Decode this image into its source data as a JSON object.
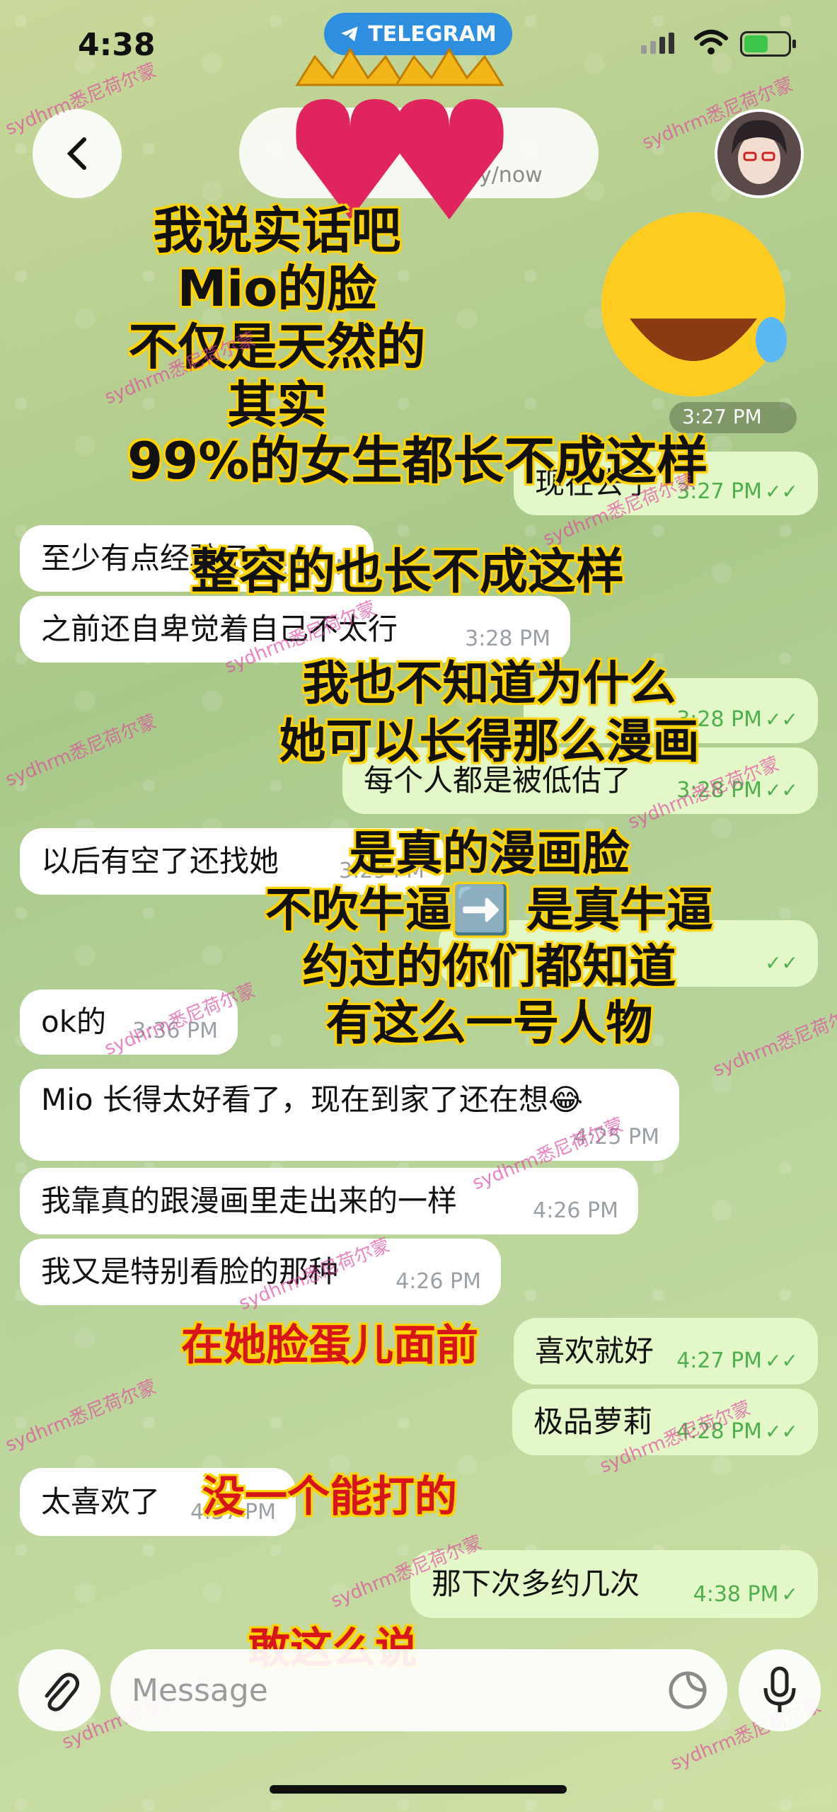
{
  "status_bar": {
    "time": "4:38",
    "app_badge": "TELEGRAM",
    "battery_level": 0.55
  },
  "header": {
    "status": "...ly/now"
  },
  "messages": [
    {
      "dir": "out",
      "text": "现在去了",
      "time": "3:27 PM",
      "check": "✓✓"
    },
    {
      "dir": "in",
      "text": "至少有点经验了",
      "time": "3:28 PM"
    },
    {
      "dir": "in",
      "text": "之前还自卑觉着自己不太行",
      "time": "3:28 PM"
    },
    {
      "dir": "out",
      "text": "",
      "time": "3:28 PM",
      "check": "✓✓"
    },
    {
      "dir": "out",
      "text": "每个人都是被低估了",
      "time": "3:28 PM",
      "check": "✓✓"
    },
    {
      "dir": "in",
      "text": "以后有空了还找她",
      "time": "3:29 PM"
    },
    {
      "dir": "out",
      "text": "",
      "time": "",
      "check": "✓✓"
    },
    {
      "dir": "in",
      "text": "ok的",
      "time": "3:36 PM"
    },
    {
      "dir": "in",
      "text": "Mio 长得太好看了，现在到家了还在想😂",
      "time": "4:25 PM"
    },
    {
      "dir": "in",
      "text": "我靠真的跟漫画里走出来的一样",
      "time": "4:26 PM"
    },
    {
      "dir": "in",
      "text": "我又是特别看脸的那种",
      "time": "4:26 PM"
    },
    {
      "dir": "out",
      "text": "喜欢就好",
      "time": "4:27 PM",
      "check": "✓✓"
    },
    {
      "dir": "out",
      "text": "极品萝莉",
      "time": "4:28 PM",
      "check": "✓✓"
    },
    {
      "dir": "in",
      "text": "太喜欢了",
      "time": "4:37 PM"
    },
    {
      "dir": "out",
      "text": "那下次多约几次",
      "time": "4:38 PM",
      "check": "✓"
    }
  ],
  "sticker_time": "3:27 PM",
  "overlay": {
    "block1": [
      "我说实话吧",
      "Mio的脸",
      "不仅是天然的",
      "其实",
      "99%的女生都长不成这样"
    ],
    "line2": "整容的也长不成这样",
    "block3": [
      "我也不知道为什么",
      "她可以长得那么漫画"
    ],
    "block4": [
      "是真的漫画脸",
      "不吹牛逼➡️ 是真牛逼",
      "约过的你们都知道",
      "有这么一号人物"
    ],
    "red": [
      "在她脸蛋儿面前",
      "没一个能打的",
      "敢这么说"
    ]
  },
  "watermark": "sydhrm悉尼荷尔蒙",
  "input": {
    "placeholder": "Message"
  }
}
